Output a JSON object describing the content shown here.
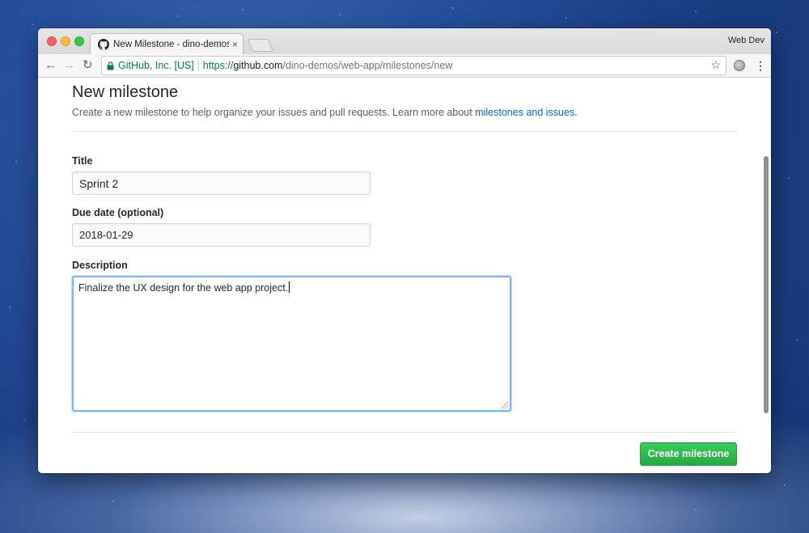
{
  "colors": {
    "accent_link": "#0366d6",
    "create_button": "#28a745",
    "secure_green": "#0b8043",
    "focus_border": "#79b8ff"
  },
  "browser": {
    "tab": {
      "title": "New Milestone - dino-demos/w",
      "favicon": "github-icon",
      "close_glyph": "×"
    },
    "profile_name": "Web Dev",
    "toolbar": {
      "back_glyph": "←",
      "forward_glyph": "→",
      "reload_glyph": "↻",
      "menu_glyph": "⋮",
      "bookmark_glyph": "☆"
    },
    "omnibox": {
      "secure_label": "GitHub, Inc. [US]",
      "url_scheme": "https://",
      "url_host": "github.com",
      "url_path": "/dino-demos/web-app/milestones/new"
    }
  },
  "page": {
    "heading": "New milestone",
    "subheading_text": "Create a new milestone to help organize your issues and pull requests. Learn more about ",
    "subheading_link": "milestones and issues",
    "subheading_end": ".",
    "form": {
      "title_label": "Title",
      "title_value": "Sprint 2",
      "due_label": "Due date (optional)",
      "due_value": "2018-01-29",
      "description_label": "Description",
      "description_value": "Finalize the UX design for the web app project."
    },
    "submit_label": "Create milestone"
  }
}
